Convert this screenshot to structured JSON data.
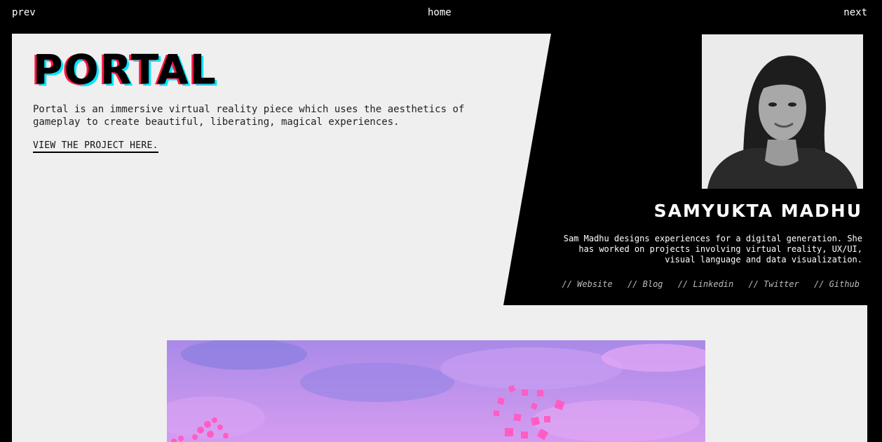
{
  "nav": {
    "prev": "prev",
    "home": "home",
    "next": "next"
  },
  "project": {
    "title": "PORTAL",
    "description": "Portal is an immersive virtual reality piece which uses the aesthetics of gameplay to create beautiful, liberating, magical experiences.",
    "link_label": "VIEW THE PROJECT HERE."
  },
  "author": {
    "name": "SAMYUKTA MADHU",
    "bio": "Sam Madhu designs experiences for a digital generation. She has worked on projects involving virtual reality, UX/UI, visual language and data visualization.",
    "links": [
      "// Website",
      "// Blog",
      "// Linkedin",
      "// Twitter",
      "// Github"
    ]
  },
  "colors": {
    "background": "#000000",
    "panel": "#efefef",
    "title_shadow_red": "#ff1744",
    "title_shadow_cyan": "#00e5ff",
    "hero_sky": "#b58af0",
    "hero_cubes": "#ff5cc4"
  }
}
